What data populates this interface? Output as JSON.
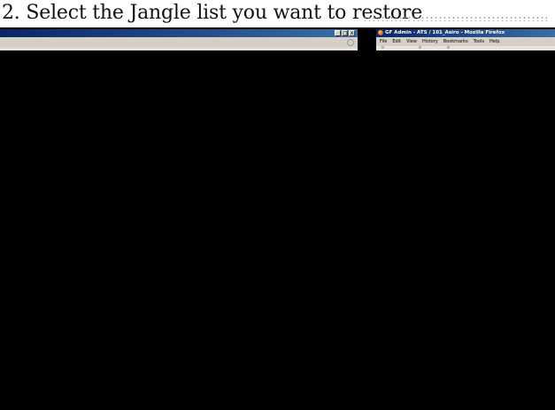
{
  "slide": {
    "title": "2. Select the Jangle list you want to restore"
  },
  "left_window": {
    "caption_buttons": [
      "_",
      "□",
      "x"
    ],
    "throbber_icon": "throbber-icon"
  },
  "right_window": {
    "title": "GF Admin - ATS / 101_Asiro - Mozilla Firefox",
    "app_icon": "firefox-icon",
    "menu": [
      "File",
      "Edit",
      "View",
      "History",
      "Bookmarks",
      "Tools",
      "Help"
    ]
  },
  "colors": {
    "titlebar_start": "#0a246a",
    "titlebar_end": "#3a6ea5",
    "chrome": "#d4d0c8",
    "content": "#000000"
  }
}
